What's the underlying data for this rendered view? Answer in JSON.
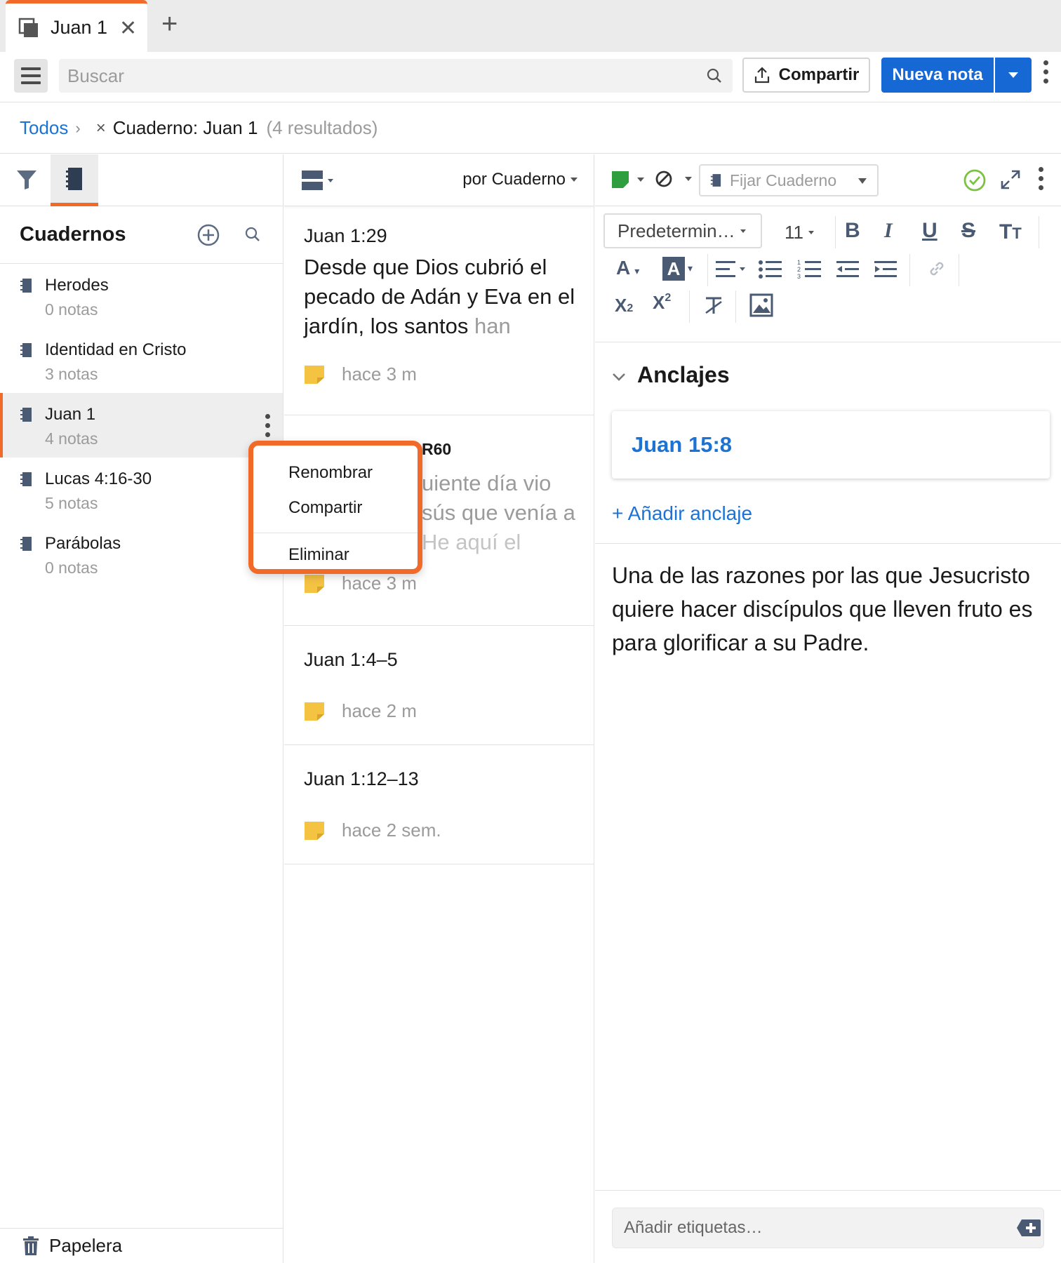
{
  "tab": {
    "label": "Juan 1",
    "close": "✕",
    "add": "+"
  },
  "toolbar": {
    "search_placeholder": "Buscar",
    "share_label": "Compartir",
    "new_note_label": "Nueva nota"
  },
  "breadcrumb": {
    "root": "Todos",
    "filter": "Cuaderno: Juan 1",
    "count": "(4 resultados)"
  },
  "left": {
    "title": "Cuadernos",
    "notebooks": [
      {
        "name": "Herodes",
        "count": "0 notas"
      },
      {
        "name": "Identidad en Cristo",
        "count": "3 notas"
      },
      {
        "name": "Juan 1",
        "count": "4 notas"
      },
      {
        "name": "Lucas 4:16-30",
        "count": "5 notas"
      },
      {
        "name": "Parábolas",
        "count": "0 notas"
      }
    ],
    "selected_index": 2,
    "trash": "Papelera"
  },
  "context_menu": {
    "items": [
      "Renombrar",
      "Compartir",
      "Eliminar"
    ]
  },
  "middle": {
    "sort_label": "por Cuaderno",
    "notes": [
      {
        "title": "Juan 1:29",
        "body": "Desde que Dios cubrió el pecado de Adán y Eva en el jardín, los santos ",
        "body_fade": "han",
        "time": "hace 3 m"
      },
      {
        "title_visible": "R60",
        "body_lines": [
          "uiente día vio",
          "sús que venía a",
          "He aquí el"
        ],
        "time": "hace 3 m"
      },
      {
        "title": "Juan 1:4–5",
        "time": "hace 2 m"
      },
      {
        "title": "Juan 1:12–13",
        "time": "hace 2 sem."
      }
    ]
  },
  "right": {
    "pin_label": "Fijar Cuaderno",
    "font_name": "Predetermin…",
    "font_size": "11",
    "anchors_title": "Anclajes",
    "anchor_link": "Juan 15:8",
    "add_anchor": "+ Añadir anclaje",
    "content": "Una de las razones por las que Jesucristo quiere hacer discípulos que lleven fruto es para glorificar a su Padre.",
    "tags_placeholder": "Añadir etiquetas…"
  },
  "colors": {
    "accent": "#f26a2a",
    "primary": "#1668d4",
    "link": "#1c73d4",
    "note_color": "#2e9e3e"
  }
}
